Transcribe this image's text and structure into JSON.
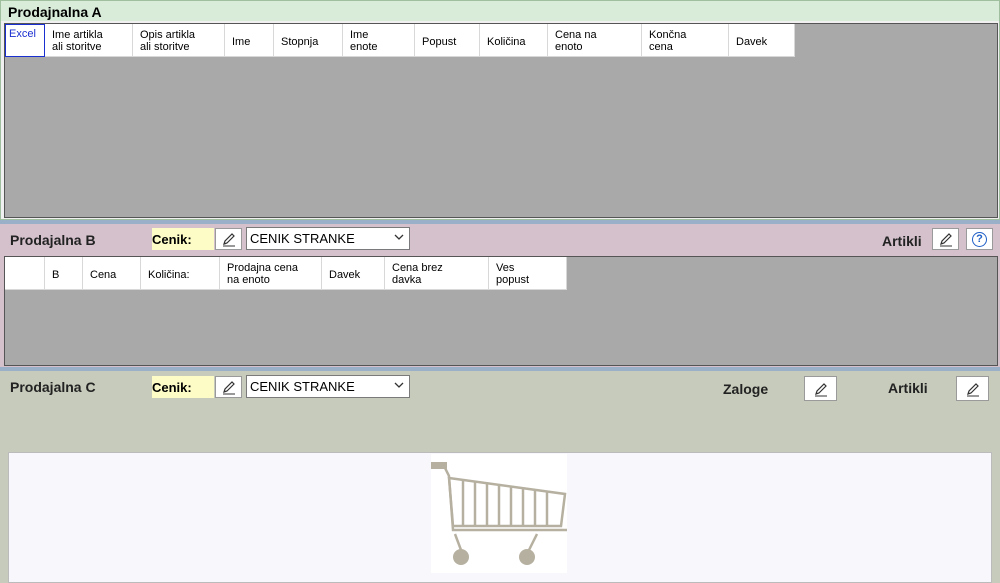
{
  "sectionA": {
    "title": "Prodajnalna A",
    "columns": [
      {
        "label": "Excel",
        "w": 40
      },
      {
        "label": "Ime artikla\nali storitve",
        "w": 88
      },
      {
        "label": "Opis artikla\nali storitve",
        "w": 92
      },
      {
        "label": "Ime",
        "w": 49
      },
      {
        "label": "Stopnja",
        "w": 69
      },
      {
        "label": "Ime\nenote",
        "w": 72
      },
      {
        "label": "Popust",
        "w": 65
      },
      {
        "label": "Količina",
        "w": 68
      },
      {
        "label": "Cena na\nenoto",
        "w": 94
      },
      {
        "label": "Končna\ncena",
        "w": 87
      },
      {
        "label": "Davek",
        "w": 66
      }
    ]
  },
  "sectionB": {
    "title": "Prodajalna B",
    "cenik_label": "Cenik:",
    "cenik_value": "CENIK STRANKE",
    "artikli_label": "Artikli",
    "columns": [
      {
        "label": "",
        "w": 40
      },
      {
        "label": "B",
        "w": 38
      },
      {
        "label": "Cena",
        "w": 58
      },
      {
        "label": "Količina:",
        "w": 79
      },
      {
        "label": "Prodajna cena\nna enoto",
        "w": 102
      },
      {
        "label": "Davek",
        "w": 63
      },
      {
        "label": "Cena brez\ndavka",
        "w": 104
      },
      {
        "label": "Ves\npopust",
        "w": 78
      }
    ]
  },
  "sectionC": {
    "title": "Prodajalna C",
    "cenik_label": "Cenik:",
    "cenik_value": "CENIK STRANKE",
    "zaloge_label": "Zaloge",
    "artikli_label": "Artikli"
  },
  "icons": {
    "edit": "pencil-icon",
    "help": "help-icon",
    "dropdown": "chevron-down-icon",
    "cart": "shopping-cart-icon"
  },
  "colors": {
    "sectionA_title_bg": "#d9ecd9",
    "sectionB_bg": "#d4c1cc",
    "sectionC_bg": "#c6cbbb",
    "cenik_label_bg": "#fdfcc6",
    "grid_bg": "#a9a9a9",
    "excel_blue": "#1a2fd0"
  }
}
